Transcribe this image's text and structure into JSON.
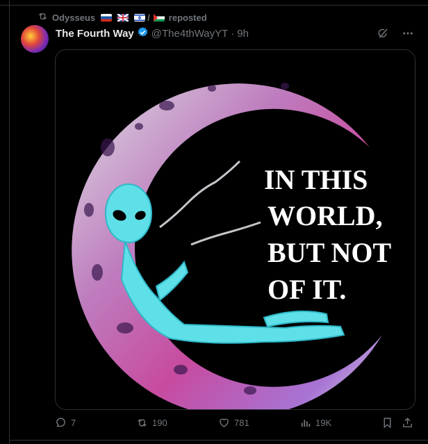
{
  "repost": {
    "user": "Odysseus",
    "suffix": "reposted",
    "separator": "/"
  },
  "author": {
    "name": "The Fourth Way",
    "handle": "@The4thWayYT",
    "dot": "·",
    "time": "9h"
  },
  "image_text": {
    "line1": "IN THIS",
    "line2": "WORLD,",
    "line3": "BUT NOT",
    "line4": "OF IT."
  },
  "stats": {
    "replies": "7",
    "reposts": "190",
    "likes": "781",
    "views": "19K"
  },
  "colors": {
    "accent": "#1d9bf0",
    "muted": "#71767b"
  }
}
